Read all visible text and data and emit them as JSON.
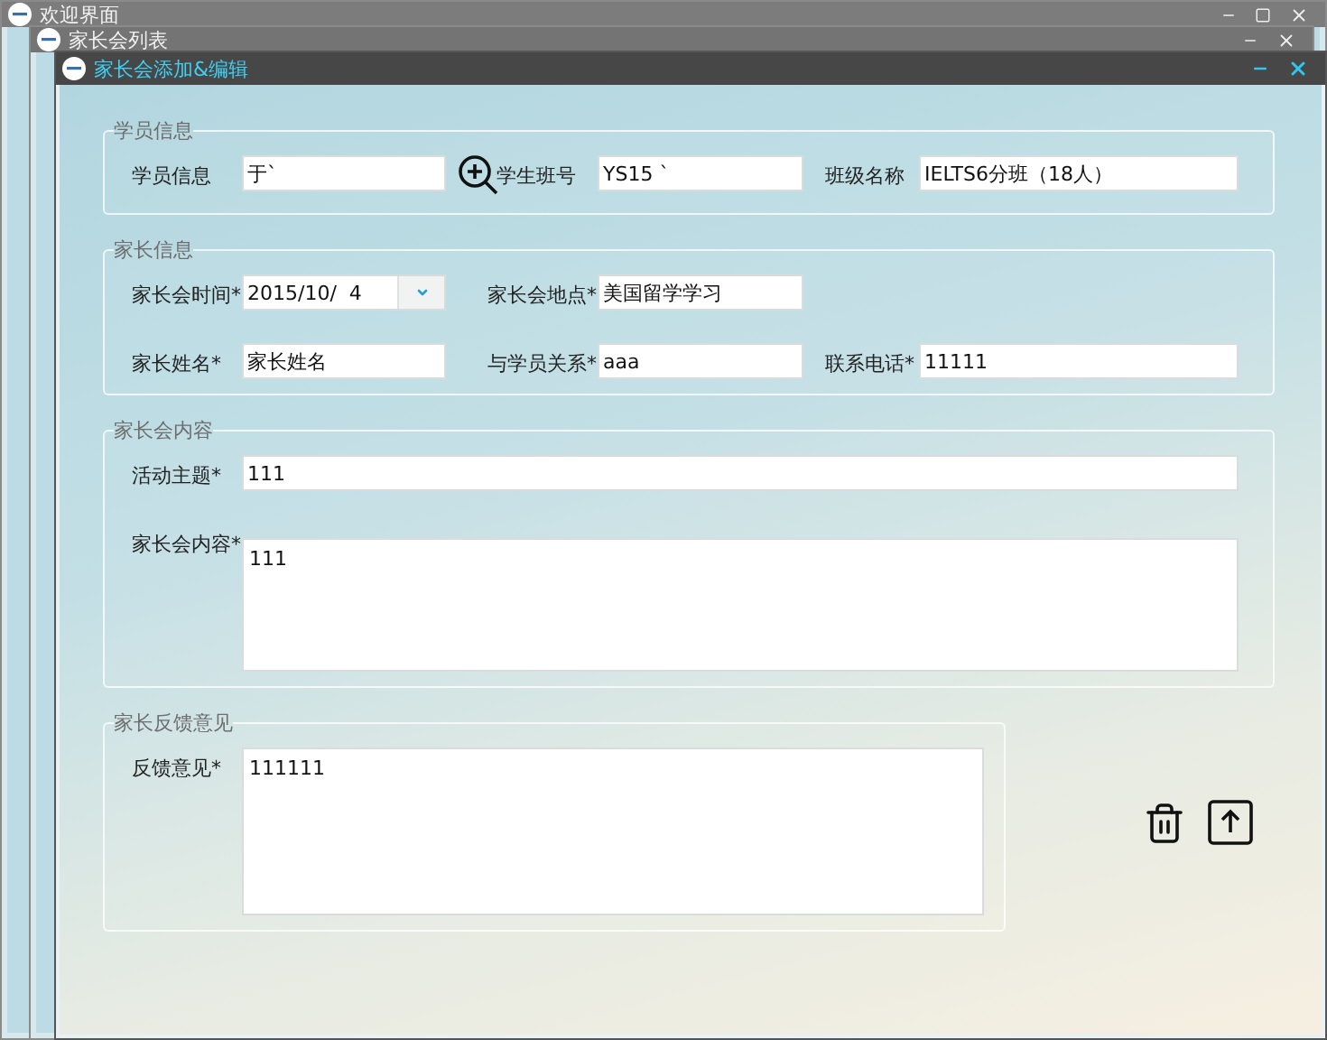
{
  "windows": [
    {
      "title": "欢迎界面",
      "maximizable": true
    },
    {
      "title": "家长会列表",
      "maximizable": false
    }
  ],
  "dialog": {
    "title": "家长会添加&编辑",
    "groups": [
      {
        "legend": "学员信息",
        "rows": [
          [
            {
              "kind": "lookup",
              "label": "学员信息",
              "value": "于`"
            },
            {
              "kind": "text",
              "label": "学生班号",
              "value": "YS15 `"
            },
            {
              "kind": "text",
              "label": "班级名称",
              "value": "IELTS6分班（18人）"
            }
          ]
        ]
      },
      {
        "legend": "家长信息",
        "rows": [
          [
            {
              "kind": "date",
              "label": "家长会时间*",
              "value": "2015/10/  4"
            },
            {
              "kind": "text",
              "label": "家长会地点*",
              "value": "美国留学学习"
            }
          ],
          [
            {
              "kind": "text",
              "label": "家长姓名*",
              "value": "家长姓名"
            },
            {
              "kind": "text",
              "label": "与学员关系*",
              "value": "aaa"
            },
            {
              "kind": "text",
              "label": "联系电话*",
              "value": "11111"
            }
          ]
        ]
      },
      {
        "legend": "家长会内容",
        "rows": [
          [
            {
              "kind": "wide",
              "label": "活动主题*",
              "value": "111"
            }
          ],
          [
            {
              "kind": "textarea",
              "label": "家长会内容*",
              "value": "111"
            }
          ]
        ]
      },
      {
        "legend": "家长反馈意见",
        "rows": [
          [
            {
              "kind": "textarea",
              "label": "反馈意见*",
              "value": "111111"
            }
          ]
        ]
      }
    ]
  }
}
